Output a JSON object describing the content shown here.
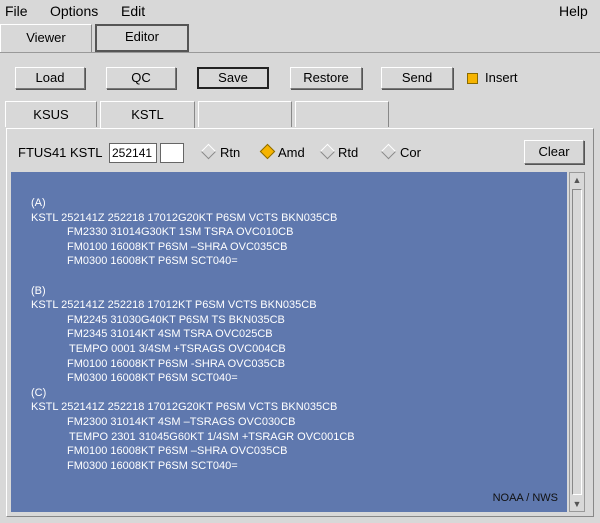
{
  "menu": {
    "file": "File",
    "options": "Options",
    "edit": "Edit",
    "help": "Help"
  },
  "mode_tabs": {
    "viewer": "Viewer",
    "editor": "Editor",
    "active": "Editor"
  },
  "toolbar": {
    "load": "Load",
    "qc": "QC",
    "save": "Save",
    "restore": "Restore",
    "send": "Send",
    "insert_label": "Insert",
    "insert_checked": true
  },
  "station_tabs": {
    "tab1": "KSUS",
    "tab2": "KSTL",
    "tab3": "",
    "tab4": "",
    "active": "KSTL"
  },
  "header": {
    "label": "FTUS41 KSTL",
    "datetime_value": "252141",
    "extra_value": "",
    "clear": "Clear"
  },
  "types": {
    "rtn": "Rtn",
    "amd": "Amd",
    "rtd": "Rtd",
    "cor": "Cor",
    "selected": "Amd"
  },
  "colors": {
    "text_background": "#5f78ae",
    "accent": "#f6b400"
  },
  "taf": {
    "a": {
      "label": "(A)",
      "line1": "KSTL 252141Z 252218 17012G20KT P6SM VCTS BKN035CB",
      "line2": "FM2330 31014G30KT 1SM TSRA OVC010CB",
      "line3": "FM0100 16008KT P6SM –SHRA OVC035CB",
      "line4": "FM0300 16008KT P6SM SCT040="
    },
    "b": {
      "label": "(B)",
      "line1": "KSTL 252141Z 252218 17012KT P6SM VCTS BKN035CB",
      "line2": "FM2245 31030G40KT P6SM TS BKN035CB",
      "line3": "FM2345 31014KT 4SM TSRA OVC025CB",
      "line4": "TEMPO 0001 3/4SM +TSRAGS OVC004CB",
      "line5": "FM0100 16008KT P6SM -SHRA OVC035CB",
      "line6": "FM0300 16008KT P6SM SCT040="
    },
    "c": {
      "label": "(C)",
      "line1": "KSTL 252141Z 252218 17012G20KT P6SM VCTS BKN035CB",
      "line2": "FM2300 31014KT 4SM –TSRAGS OVC030CB",
      "line3": "TEMPO 2301 31045G60KT 1/4SM +TSRAGR OVC001CB",
      "line4": "FM0100 16008KT P6SM –SHRA OVC035CB",
      "line5": "FM0300 16008KT P6SM SCT040="
    },
    "watermark": "NOAA / NWS"
  }
}
